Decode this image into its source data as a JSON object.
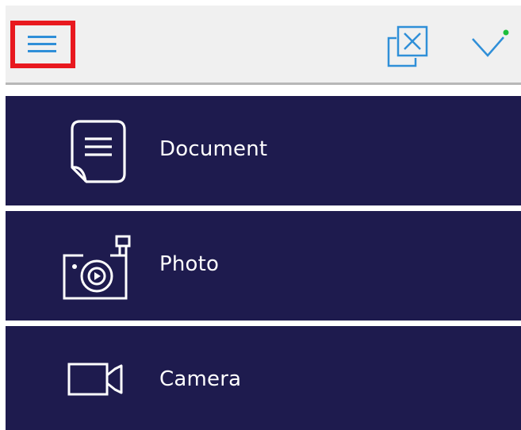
{
  "toolbar": {
    "menu_icon": "hamburger-menu-icon",
    "close_icon": "close-copy-icon",
    "confirm_icon": "check-icon",
    "colors": {
      "bar_bg": "#f0f0f0",
      "icon_blue": "#2f8fd8",
      "highlight": "#e8191f",
      "status_dot": "#1dbf3a"
    }
  },
  "menu": {
    "items": [
      {
        "label": "Document",
        "icon": "document-icon"
      },
      {
        "label": "Photo",
        "icon": "photo-camera-icon"
      },
      {
        "label": "Camera",
        "icon": "video-camera-icon"
      }
    ],
    "colors": {
      "item_bg": "#1e1b4e",
      "item_text": "#ffffff"
    }
  }
}
